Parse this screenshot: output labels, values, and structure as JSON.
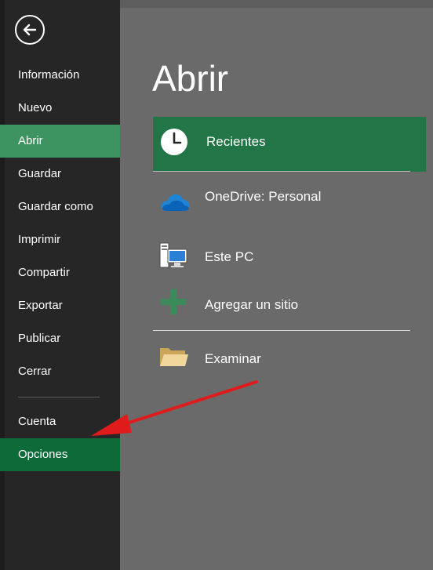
{
  "sidebar": {
    "back_icon": "back-arrow-icon",
    "items": [
      {
        "label": "Información"
      },
      {
        "label": "Nuevo"
      },
      {
        "label": "Abrir"
      },
      {
        "label": "Guardar"
      },
      {
        "label": "Guardar como"
      },
      {
        "label": "Imprimir"
      },
      {
        "label": "Compartir"
      },
      {
        "label": "Exportar"
      },
      {
        "label": "Publicar"
      },
      {
        "label": "Cerrar"
      }
    ],
    "bottom_items": [
      {
        "label": "Cuenta"
      },
      {
        "label": "Opciones"
      }
    ],
    "active_item": "Abrir",
    "highlighted_item": "Opciones"
  },
  "main": {
    "title": "Abrir",
    "locations": [
      {
        "label": "Recientes",
        "icon": "clock-icon"
      },
      {
        "label": "OneDrive: Personal",
        "icon": "onedrive-cloud-icon"
      },
      {
        "label": "Este PC",
        "icon": "computer-icon"
      },
      {
        "label": "Agregar un sitio",
        "icon": "plus-icon"
      },
      {
        "label": "Examinar",
        "icon": "folder-icon"
      }
    ]
  },
  "colors": {
    "sidebar_bg": "#262626",
    "main_bg": "#6a6a6a",
    "active_item": "#3e9461",
    "options_item": "#0d6a39",
    "recent_selected": "#227547",
    "annotation_arrow": "#e01b1b"
  }
}
